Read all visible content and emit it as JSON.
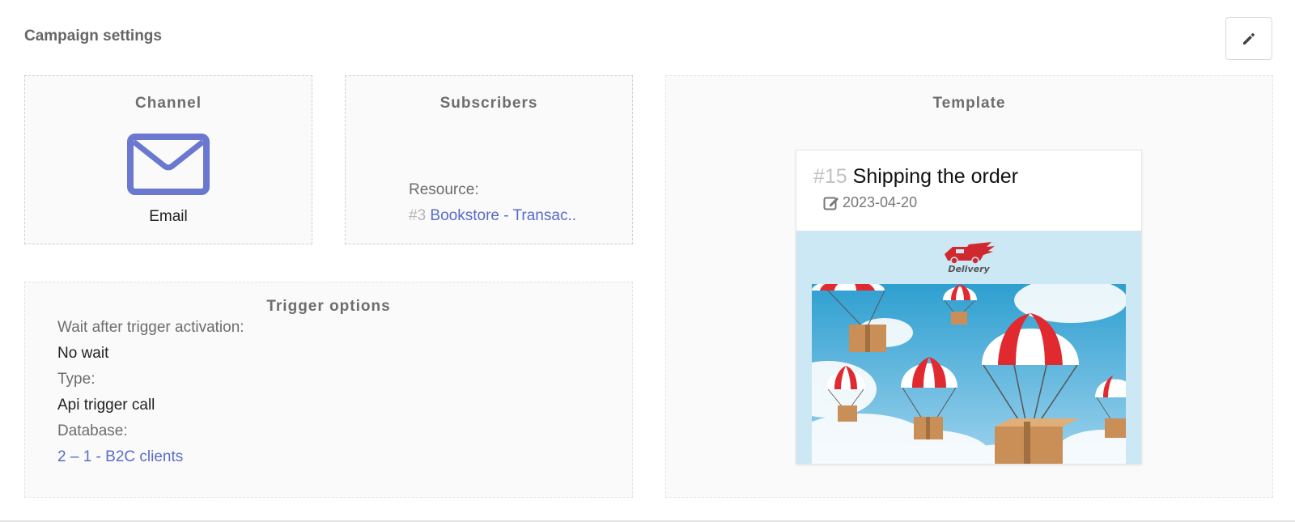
{
  "header": {
    "title": "Campaign settings",
    "edit_icon": "pencil-icon"
  },
  "channel": {
    "heading": "Channel",
    "icon": "envelope-icon",
    "label": "Email"
  },
  "subscribers": {
    "heading": "Subscribers",
    "resource_label": "Resource:",
    "resource_id": "#3",
    "resource_name": "Bookstore - Transac.."
  },
  "trigger_options": {
    "heading": "Trigger options",
    "wait_label": "Wait after trigger activation:",
    "wait_value": "No wait",
    "type_label": "Type:",
    "type_value": "Api trigger call",
    "database_label": "Database:",
    "database_value": "2 – 1 - B2C clients"
  },
  "template": {
    "heading": "Template",
    "id": "#15",
    "name": "Shipping the order",
    "date_icon": "edit-icon",
    "date": "2023-04-20",
    "logo_text": "Delivery"
  },
  "colors": {
    "link": "#5a6bc8",
    "icon_accent": "#6b78cf",
    "heading": "#6d6d6d",
    "preview_bg": "#cce8f4"
  }
}
